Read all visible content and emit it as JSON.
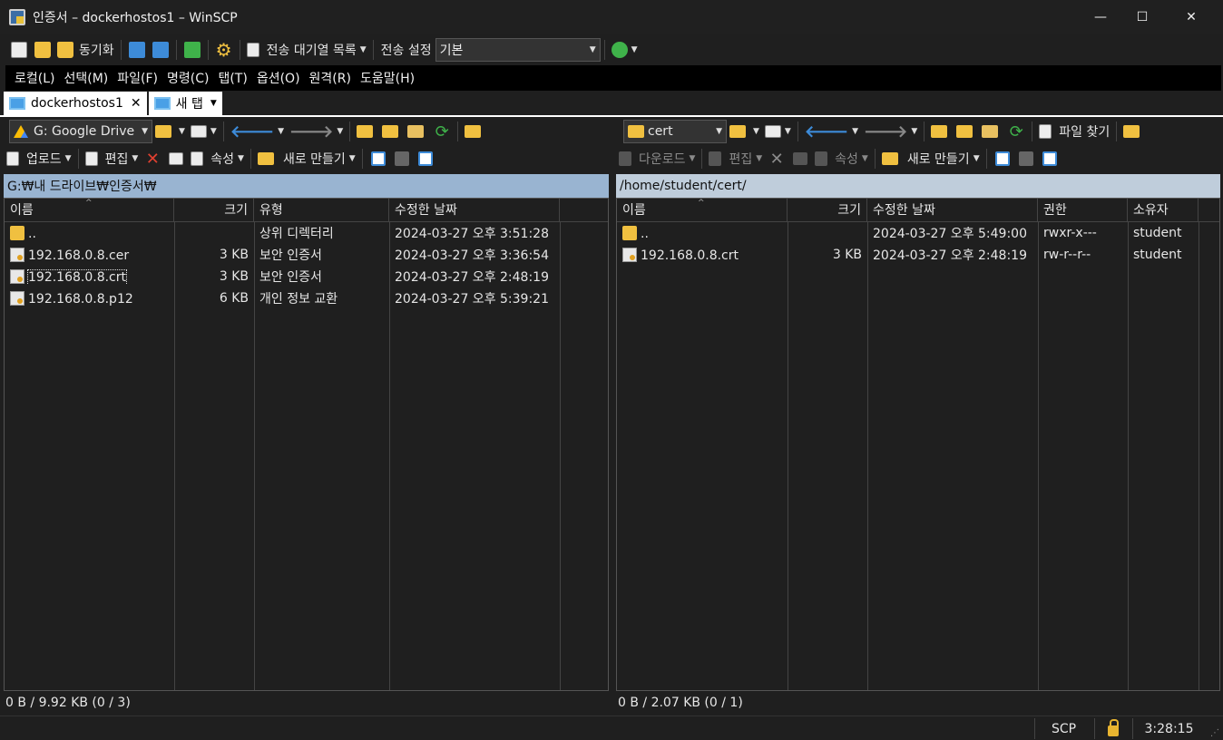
{
  "window": {
    "title": "인증서 – dockerhostos1 – WinSCP",
    "controls": {
      "minimize": "—",
      "maximize": "☐",
      "close": "✕"
    }
  },
  "toolbar": {
    "sync_label": "동기화",
    "queue_label": "전송 대기열 목록",
    "transfer_settings_label": "전송 설정",
    "transfer_preset": "기본"
  },
  "menu": {
    "items": [
      "로컬(L)",
      "선택(M)",
      "파일(F)",
      "명령(C)",
      "탭(T)",
      "옵션(O)",
      "원격(R)",
      "도움말(H)"
    ]
  },
  "tabs": {
    "session": "dockerhostos1",
    "close_glyph": "✕",
    "new_tab": "새 탭"
  },
  "local": {
    "drive": "G: Google Drive",
    "upload_label": "업로드",
    "edit_label": "편집",
    "properties_label": "속성",
    "new_label": "새로 만들기",
    "path": "G:₩내 드라이브₩인증서₩",
    "columns": {
      "name": "이름",
      "size": "크기",
      "type": "유형",
      "modified": "수정한 날짜"
    },
    "files": [
      {
        "name": "..",
        "size": "",
        "type": "상위 디렉터리",
        "modified": "2024-03-27 오후 3:51:28",
        "icon": "parent-folder-icon"
      },
      {
        "name": "192.168.0.8.cer",
        "size": "3 KB",
        "type": "보안 인증서",
        "modified": "2024-03-27 오후 3:36:54",
        "icon": "certificate-icon"
      },
      {
        "name": "192.168.0.8.crt",
        "size": "3 KB",
        "type": "보안 인증서",
        "modified": "2024-03-27 오후 2:48:19",
        "icon": "certificate-icon"
      },
      {
        "name": "192.168.0.8.p12",
        "size": "6 KB",
        "type": "개인 정보 교환",
        "modified": "2024-03-27 오후 5:39:21",
        "icon": "certificate-icon"
      }
    ],
    "status": "0 B / 9.92 KB (0 / 3)"
  },
  "remote": {
    "dir": "cert",
    "find_label": "파일 찾기",
    "download_label": "다운로드",
    "edit_label": "편집",
    "properties_label": "속성",
    "new_label": "새로 만들기",
    "path": "/home/student/cert/",
    "columns": {
      "name": "이름",
      "size": "크기",
      "modified": "수정한 날짜",
      "rights": "권한",
      "owner": "소유자"
    },
    "files": [
      {
        "name": "..",
        "size": "",
        "modified": "2024-03-27 오후 5:49:00",
        "rights": "rwxr-x---",
        "owner": "student",
        "icon": "parent-folder-icon"
      },
      {
        "name": "192.168.0.8.crt",
        "size": "3 KB",
        "modified": "2024-03-27 오후 2:48:19",
        "rights": "rw-r--r--",
        "owner": "student",
        "icon": "certificate-icon"
      }
    ],
    "status": "0 B / 2.07 KB (0 / 1)"
  },
  "statusbar": {
    "protocol": "SCP",
    "time": "3:28:15"
  },
  "colors": {
    "local_path_bg": "#99b4d1",
    "remote_path_bg": "#bfcddb",
    "background": "#1f1f1f"
  }
}
